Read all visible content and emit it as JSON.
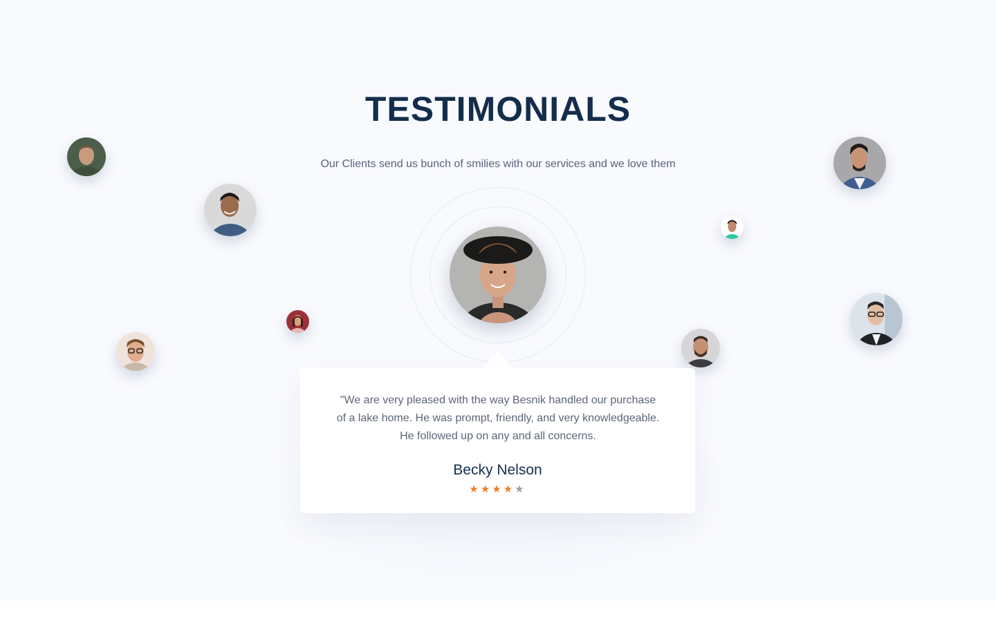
{
  "section": {
    "title": "TESTIMONIALS",
    "subtitle": "Our Clients send us bunch of smilies with our services and we love them"
  },
  "testimonial": {
    "quote": "\"We are very pleased with the way Besnik handled our purchase of a lake home. He was prompt, friendly, and very knowledgeable. He followed up on any and all concerns.",
    "author": "Becky Nelson",
    "rating": 4,
    "rating_max": 5
  },
  "avatars": [
    {
      "id": "client-1",
      "icon": "person-photo"
    },
    {
      "id": "client-2",
      "icon": "person-photo"
    },
    {
      "id": "client-3",
      "icon": "person-photo"
    },
    {
      "id": "client-4",
      "icon": "person-photo"
    },
    {
      "id": "client-5",
      "icon": "person-photo"
    },
    {
      "id": "client-6",
      "icon": "person-photo"
    },
    {
      "id": "client-7",
      "icon": "person-photo"
    },
    {
      "id": "client-8",
      "icon": "person-photo"
    },
    {
      "id": "client-9",
      "icon": "person-photo"
    }
  ],
  "colors": {
    "heading": "#142d4c",
    "text": "#5c6577",
    "star_active": "#ef7d27",
    "star_inactive": "#9aa0a8",
    "background": "#f9fafe"
  }
}
